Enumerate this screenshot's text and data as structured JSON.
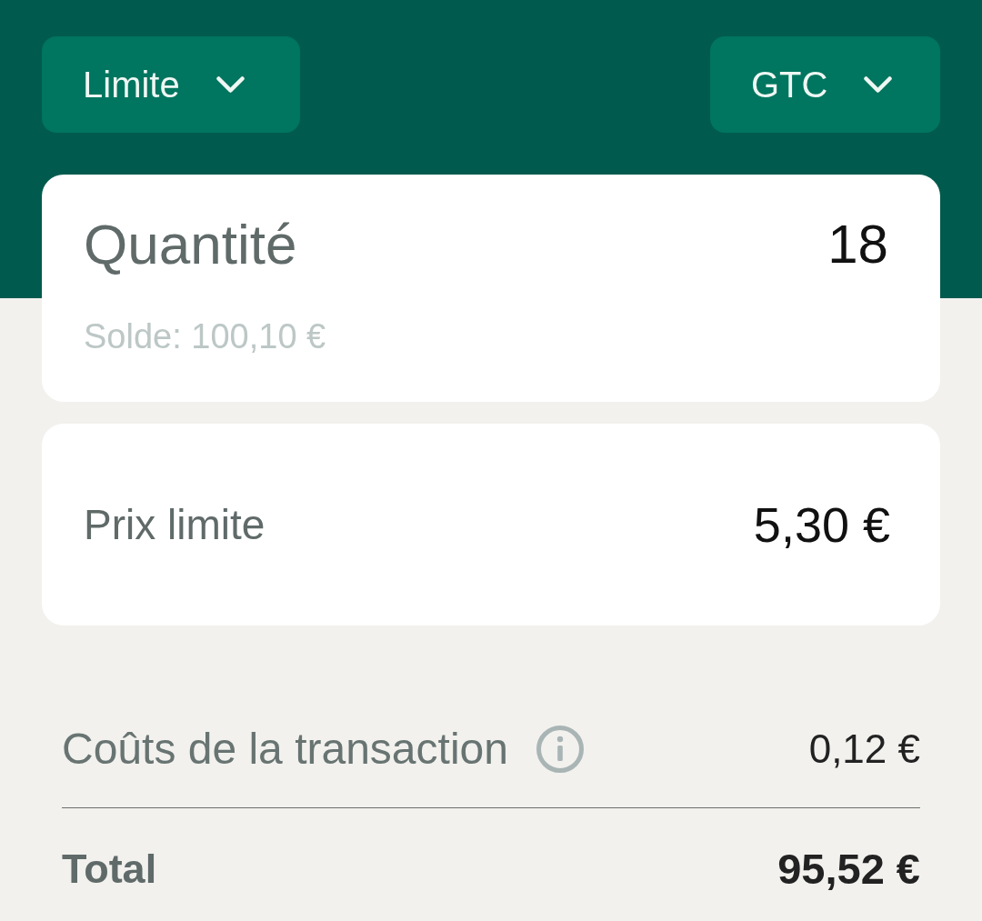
{
  "dropdowns": [
    {
      "label": "Limite"
    },
    {
      "label": "GTC"
    }
  ],
  "quantity": {
    "label": "Quantité",
    "value": "18",
    "balance": "Solde: 100,10 €"
  },
  "limit_price": {
    "label": "Prix limite",
    "value": "5,30 €"
  },
  "summary": [
    {
      "kind": "fee",
      "label": "Coûts de la transaction",
      "value": "0,12 €",
      "info": true
    },
    {
      "kind": "total",
      "label": "Total",
      "value": "95,52 €",
      "info": false
    }
  ]
}
